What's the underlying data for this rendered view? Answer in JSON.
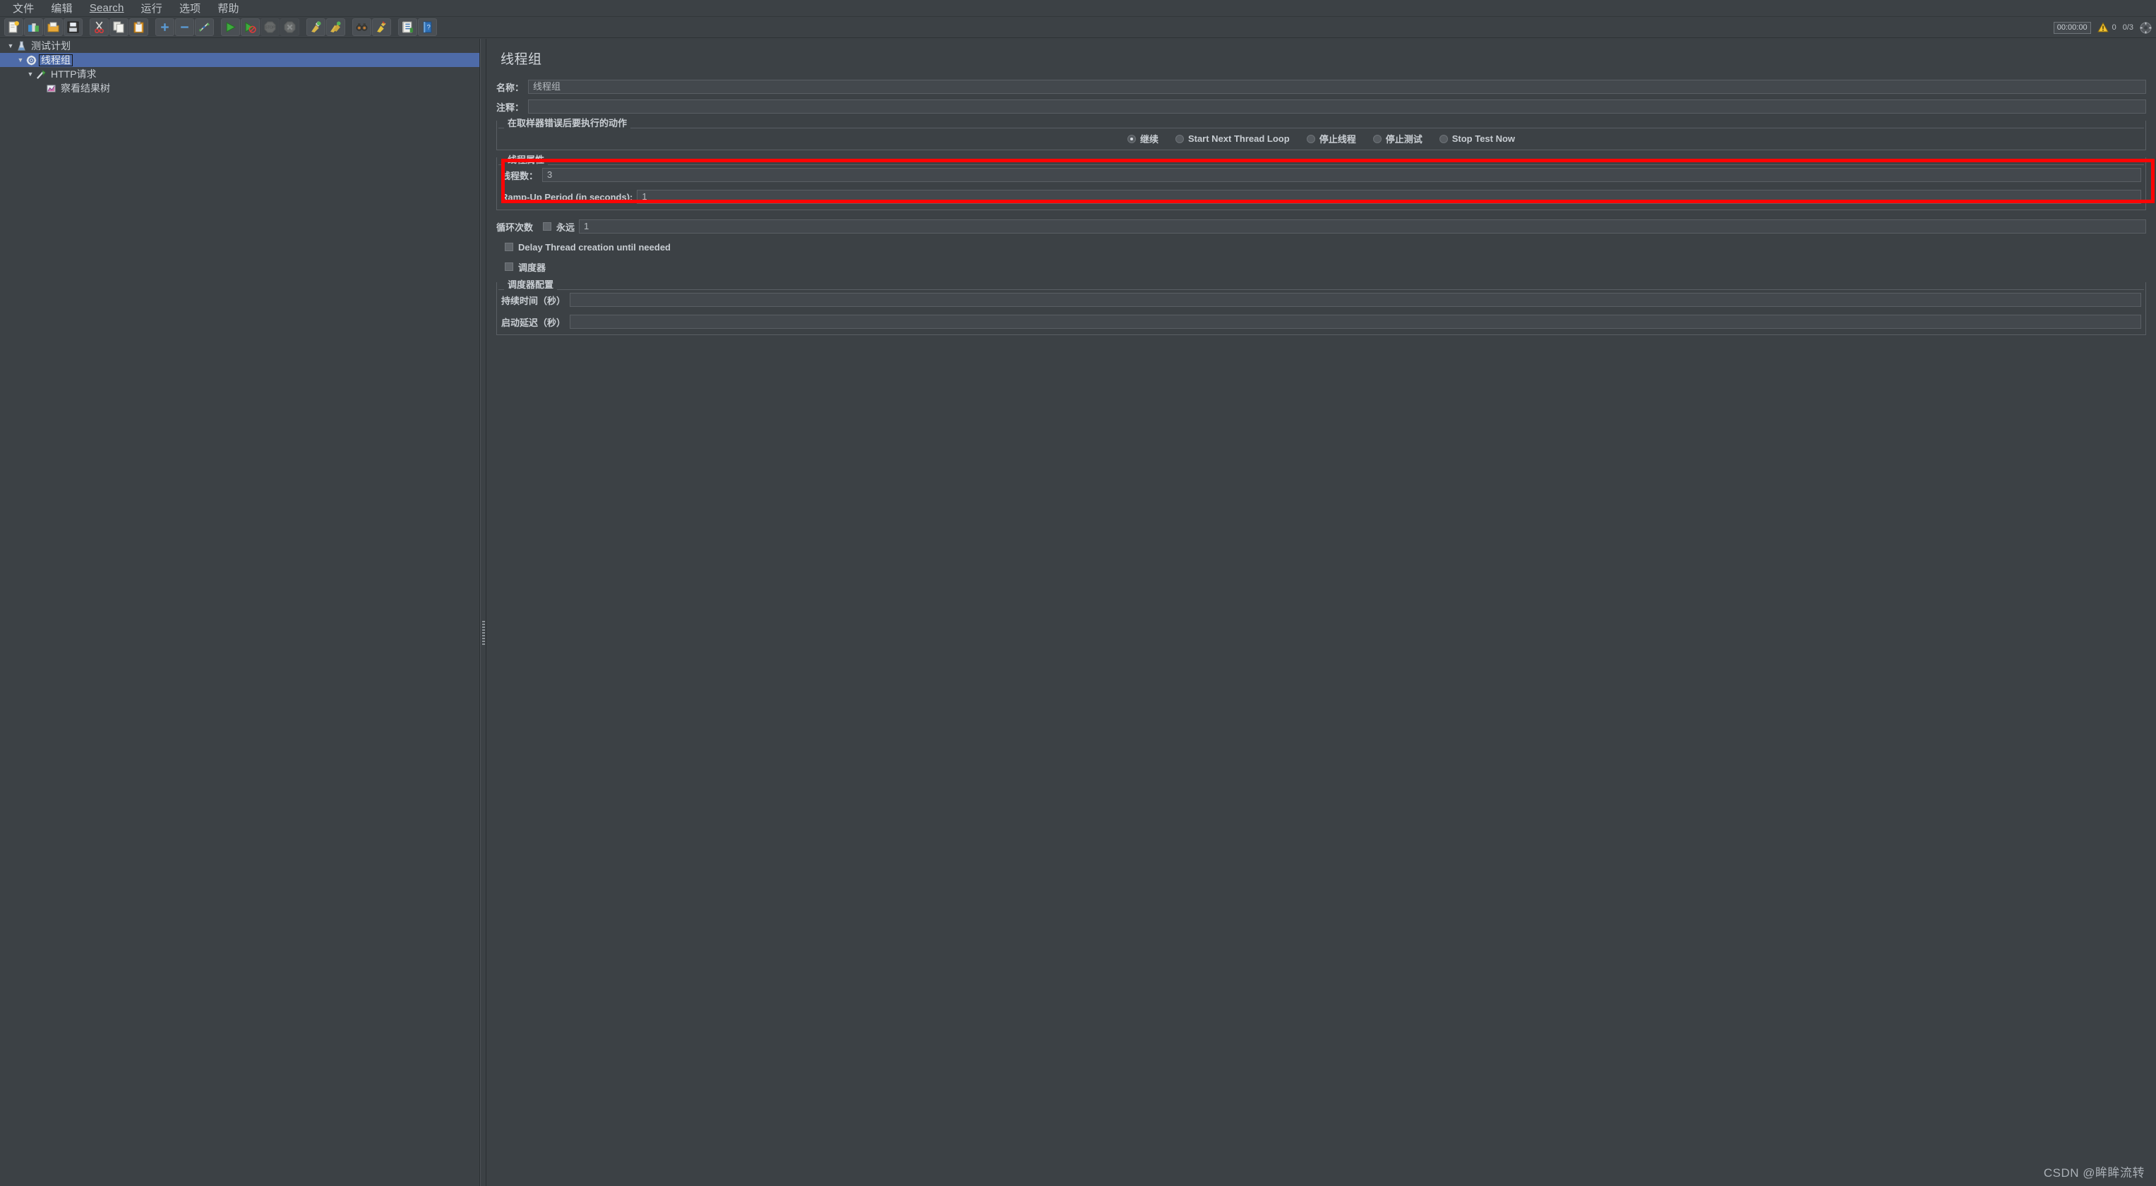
{
  "menubar": {
    "items": [
      {
        "label": "文件",
        "mnemonic": ""
      },
      {
        "label": "编辑",
        "mnemonic": ""
      },
      {
        "label": "Search",
        "mnemonic": "S"
      },
      {
        "label": "运行",
        "mnemonic": ""
      },
      {
        "label": "选项",
        "mnemonic": ""
      },
      {
        "label": "帮助",
        "mnemonic": ""
      }
    ]
  },
  "toolbar": {
    "buttons": [
      {
        "name": "new-test-plan-icon",
        "title": "新建"
      },
      {
        "name": "templates-icon",
        "title": "模板"
      },
      {
        "name": "open-icon",
        "title": "打开"
      },
      {
        "name": "save-icon",
        "title": "保存"
      },
      {
        "name": "cut-icon",
        "title": "剪切"
      },
      {
        "name": "copy-icon",
        "title": "复制"
      },
      {
        "name": "paste-icon",
        "title": "粘贴"
      },
      {
        "name": "expand-all-icon",
        "title": "展开全部"
      },
      {
        "name": "collapse-all-icon",
        "title": "折叠全部"
      },
      {
        "name": "toggle-icon",
        "title": "启用/禁用"
      },
      {
        "name": "start-icon",
        "title": "启动"
      },
      {
        "name": "start-no-pauses-icon",
        "title": "无间隔启动"
      },
      {
        "name": "stop-icon",
        "title": "停止"
      },
      {
        "name": "shutdown-icon",
        "title": "关闭"
      },
      {
        "name": "clear-icon",
        "title": "清除"
      },
      {
        "name": "clear-all-icon",
        "title": "清除全部"
      },
      {
        "name": "search-icon",
        "title": "搜索"
      },
      {
        "name": "reset-search-icon",
        "title": "重置搜索"
      },
      {
        "name": "function-helper-icon",
        "title": "函数助手"
      },
      {
        "name": "help-icon",
        "title": "帮助"
      }
    ]
  },
  "status": {
    "timer": "00:00:00",
    "warning_count": "0",
    "threads": "0/3",
    "spinner_name": "activity-indicator-icon"
  },
  "tree": {
    "nodes": [
      {
        "label": "测试计划",
        "icon": "test-plan-icon",
        "depth": 0,
        "expanded": true,
        "selected": false
      },
      {
        "label": "线程组",
        "icon": "thread-group-icon",
        "depth": 1,
        "expanded": true,
        "selected": true
      },
      {
        "label": "HTTP请求",
        "icon": "http-request-icon",
        "depth": 2,
        "expanded": true,
        "selected": false
      },
      {
        "label": "察看结果树",
        "icon": "view-results-tree-icon",
        "depth": 3,
        "expanded": false,
        "selected": false
      }
    ]
  },
  "panel": {
    "title": "线程组",
    "name_label": "名称：",
    "name_value": "线程组",
    "comment_label": "注释：",
    "comment_value": "",
    "sampler_error_group": "在取样器错误后要执行的动作",
    "error_actions": [
      {
        "label": "继续",
        "checked": true
      },
      {
        "label": "Start Next Thread Loop",
        "checked": false
      },
      {
        "label": "停止线程",
        "checked": false
      },
      {
        "label": "停止测试",
        "checked": false
      },
      {
        "label": "Stop Test Now",
        "checked": false
      }
    ],
    "thread_properties_group": "线程属性",
    "num_threads_label": "线程数：",
    "num_threads_value": "3",
    "ramp_up_label": "Ramp-Up Period (in seconds):",
    "ramp_up_value": "1",
    "loop_count_label": "循环次数",
    "forever_label": "永远",
    "forever_checked": false,
    "loop_count_value": "1",
    "delay_thread_label": "Delay Thread creation until needed",
    "delay_thread_checked": false,
    "scheduler_label": "调度器",
    "scheduler_checked": false,
    "scheduler_group": "调度器配置",
    "duration_label": "持续时间（秒）",
    "duration_value": "",
    "startup_delay_label": "启动延迟（秒）",
    "startup_delay_value": ""
  },
  "annotation": {
    "highlight_color": "#fb0505",
    "name": "thread-properties-highlight"
  },
  "watermark": {
    "text": "CSDN @眸眸流转"
  }
}
